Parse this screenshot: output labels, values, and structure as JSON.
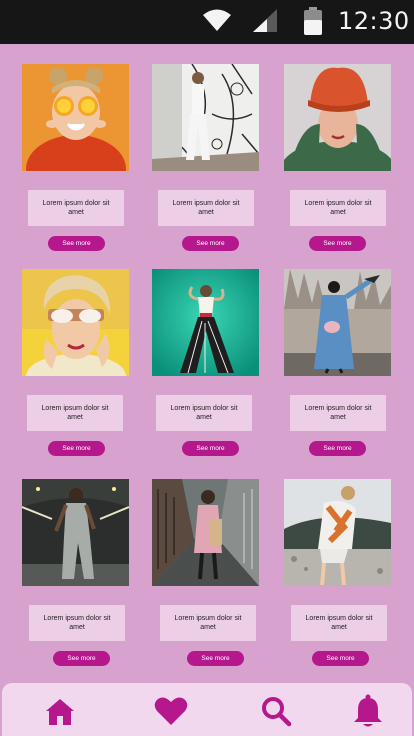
{
  "status_bar": {
    "time": "12:30"
  },
  "colors": {
    "background": "#d8a2cf",
    "accent": "#b4188c",
    "caption_bg": "#eccee6",
    "nav_bg": "#f2d8ee"
  },
  "gallery": {
    "items": [
      {
        "caption": "Lorem ipsum dolor sit amet",
        "button": "See more"
      },
      {
        "caption": "Lorem ipsum dolor sit amet",
        "button": "See more"
      },
      {
        "caption": "Lorem ipsum dolor sit amet",
        "button": "See more"
      },
      {
        "caption": "Lorem ipsum dolor sit amet",
        "button": "See more"
      },
      {
        "caption": "Lorem ipsum dolor sit amet",
        "button": "See more"
      },
      {
        "caption": "Lorem ipsum dolor sit amet",
        "button": "See more"
      },
      {
        "caption": "Lorem ipsum dolor sit amet",
        "button": "See more"
      },
      {
        "caption": "Lorem ipsum dolor sit amet",
        "button": "See more"
      },
      {
        "caption": "Lorem ipsum dolor sit amet",
        "button": "See more"
      }
    ]
  },
  "bottom_nav": {
    "items": [
      {
        "icon": "home-icon"
      },
      {
        "icon": "heart-icon"
      },
      {
        "icon": "search-icon"
      },
      {
        "icon": "bell-icon"
      }
    ]
  }
}
